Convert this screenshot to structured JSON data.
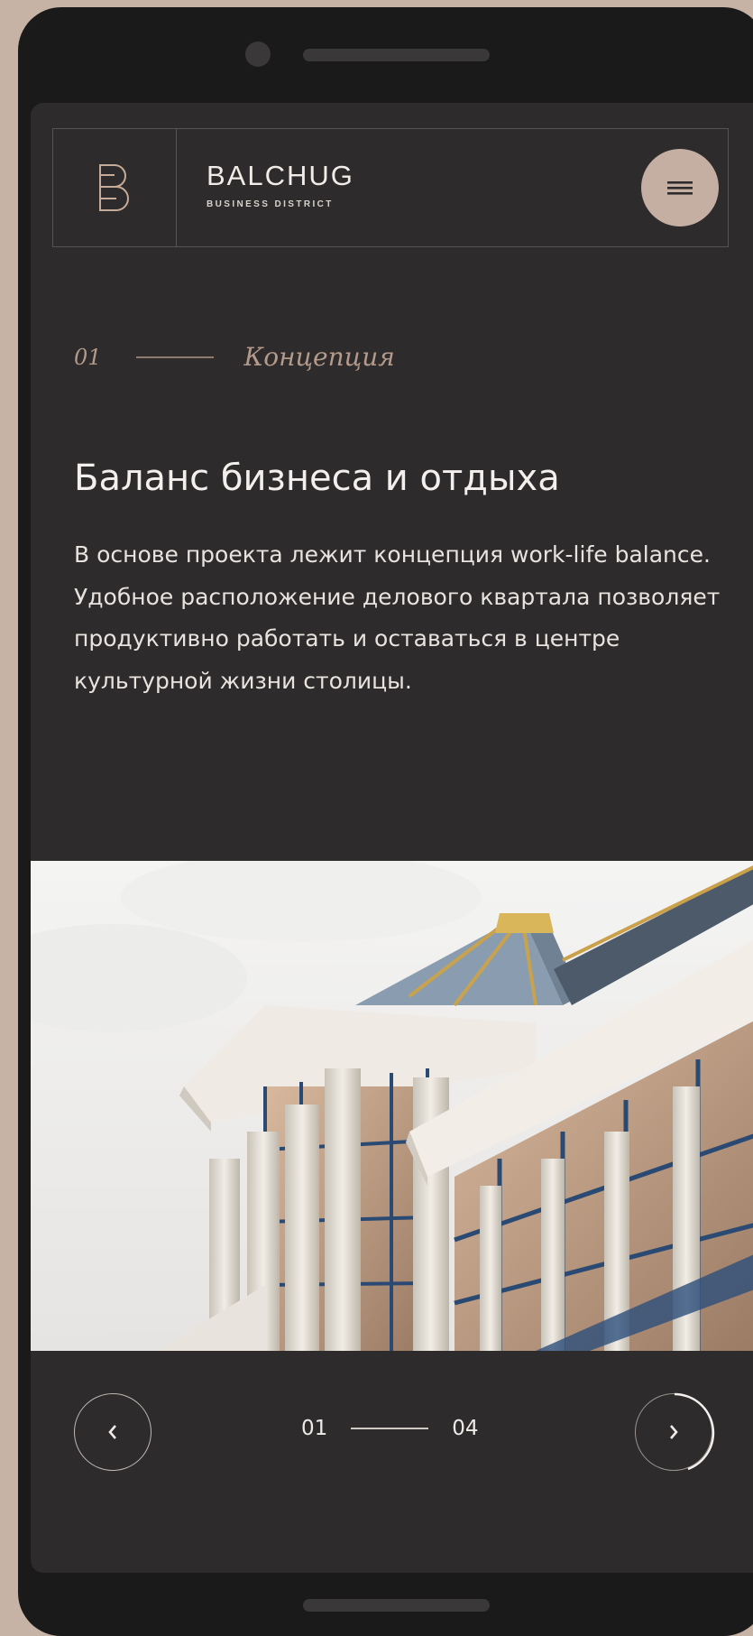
{
  "colors": {
    "background": "#c7b2a6",
    "phone_body": "#1b1a1a",
    "screen": "#2d2b2b",
    "accent": "#c5aea2",
    "section_text": "#b39a8b",
    "heading_text": "#f3efec"
  },
  "header": {
    "logo_icon": "balchug-b-logo",
    "brand_name": "BALCHUG",
    "brand_subtitle": "BUSINESS DISTRICT",
    "menu_icon": "hamburger-menu-icon"
  },
  "section": {
    "number": "01",
    "title": "Концепция"
  },
  "content": {
    "heading": "Баланс бизнеса и отдыха",
    "body": "В основе проекта лежит концепция work-life balance. Удобное расположение делового квартала позволяет продуктивно работать и оставаться в центре культурной жизни столицы."
  },
  "image": {
    "subject": "building-facade-photo"
  },
  "slider": {
    "current": "01",
    "total": "04",
    "prev_icon": "chevron-left-icon",
    "next_icon": "chevron-right-icon"
  }
}
